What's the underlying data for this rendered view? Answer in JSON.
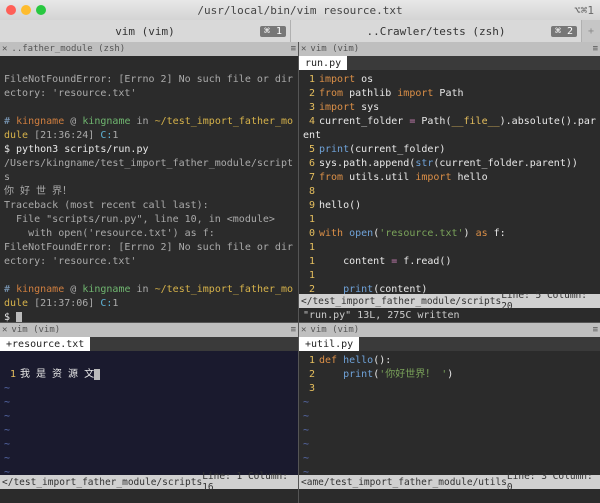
{
  "window": {
    "title": "/usr/local/bin/vim resource.txt",
    "shortcut": "⌥⌘1"
  },
  "tabs": [
    {
      "label": "vim (vim)",
      "badge": "⌘ 1"
    },
    {
      "label": "..Crawler/tests (zsh)",
      "badge": "⌘ 2"
    }
  ],
  "panes": {
    "tl": {
      "header_left": "..father_module (zsh)",
      "header_right": "≡",
      "err1": "FileNotFoundError: [Errno 2] No such file or directory: 'resource.txt'",
      "prompt1": {
        "hash": "#",
        "user": "kingname",
        "at": "@",
        "host": "kingname",
        "in": "in",
        "path": "~/test_import_father_module",
        "time": "[21:36:24]",
        "c": "C:",
        "one": "1"
      },
      "cmd1": "$ python3 scripts/run.py",
      "out1": "/Users/kingname/test_import_father_module/scripts",
      "out2": "你 好 世 界！",
      "tb1": "Traceback (most recent call last):",
      "tb2": "  File \"scripts/run.py\", line 10, in <module>",
      "tb3": "    with open('resource.txt') as f:",
      "err2": "FileNotFoundError: [Errno 2] No such file or directory: 'resource.txt'",
      "prompt2": {
        "hash": "#",
        "user": "kingname",
        "at": "@",
        "host": "kingname",
        "in": "in",
        "path": "~/test_import_father_module",
        "time": "[21:37:06]",
        "c": "C:",
        "one": "1"
      },
      "dollar": "$ "
    },
    "tr": {
      "header_left": "vim (vim)",
      "header_right": "≡",
      "tabname": "run.py",
      "lines": [
        [
          [
            "o",
            "import"
          ],
          [
            "w",
            " os"
          ]
        ],
        [
          [
            "o",
            "from"
          ],
          [
            "w",
            " pathlib "
          ],
          [
            "o",
            "import"
          ],
          [
            "w",
            " Path"
          ]
        ],
        [
          [
            "o",
            "import"
          ],
          [
            "w",
            " sys"
          ]
        ],
        [
          [
            "w",
            "current_folder "
          ],
          [
            "p",
            "="
          ],
          [
            "w",
            " Path("
          ],
          [
            "y",
            "__file__"
          ],
          [
            "w",
            ").absolute().parent"
          ]
        ],
        [
          [
            "b",
            "print"
          ],
          [
            "w",
            "(current_folder)"
          ]
        ],
        [
          [
            "w",
            "sys.path.append("
          ],
          [
            "b",
            "str"
          ],
          [
            "w",
            "(current_folder.parent))"
          ]
        ],
        [
          [
            "o",
            "from"
          ],
          [
            "w",
            " utils.util "
          ],
          [
            "o",
            "import"
          ],
          [
            "w",
            " hello"
          ]
        ],
        [
          [
            "w",
            ""
          ]
        ],
        [
          [
            "w",
            "hello()"
          ]
        ],
        [
          [
            "o",
            "with"
          ],
          [
            "w",
            " "
          ],
          [
            "b",
            "open"
          ],
          [
            "w",
            "("
          ],
          [
            "g",
            "'resource.txt'"
          ],
          [
            "w",
            ") "
          ],
          [
            "o",
            "as"
          ],
          [
            "w",
            " f:"
          ]
        ],
        [
          [
            "w",
            "    content "
          ],
          [
            "p",
            "="
          ],
          [
            "w",
            " f.read()"
          ]
        ],
        [
          [
            "w",
            "    "
          ],
          [
            "b",
            "print"
          ],
          [
            "w",
            "(content)"
          ]
        ],
        [
          [
            "w",
            ""
          ]
        ]
      ],
      "status_left": "</test_import_father_module/scripts",
      "status_right": "Line:   5  Column:  20",
      "msg": "\"run.py\" 13L, 275C written"
    },
    "bl": {
      "header_left": "vim (vim)",
      "header_right": "≡",
      "tabmod": "+",
      "tabname": "resource.txt",
      "line1": "我 是 资 源 文",
      "status_left": "</test_import_father_module/scripts",
      "status_right": "Line:   1  Column:  16"
    },
    "br": {
      "header_left": "vim (vim)",
      "header_right": "≡",
      "tabmod": "+",
      "tabname": "util.py",
      "lines": [
        [
          [
            "o",
            "def"
          ],
          [
            "w",
            " "
          ],
          [
            "b",
            "hello"
          ],
          [
            "w",
            "():"
          ]
        ],
        [
          [
            "w",
            "    "
          ],
          [
            "b",
            "print"
          ],
          [
            "w",
            "("
          ],
          [
            "g",
            "'你好世界！ '"
          ],
          [
            "w",
            ")"
          ]
        ],
        [
          [
            "w",
            ""
          ]
        ]
      ],
      "status_left": "<ame/test_import_father_module/utils",
      "status_right": "Line:   3  Column:   0"
    }
  }
}
